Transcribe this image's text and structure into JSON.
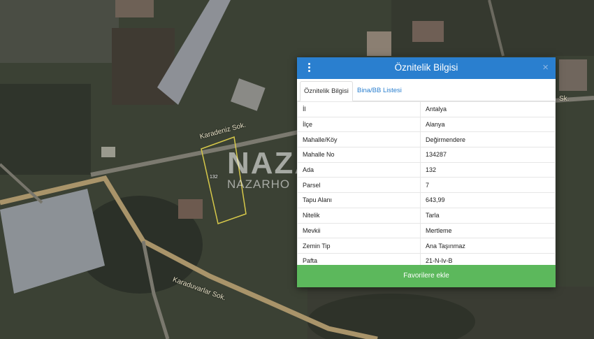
{
  "map": {
    "road_label_1": "Karadeniz Sok.",
    "road_label_2": "Karaduvarlar Sok.",
    "road_label_3": "Sk.",
    "parcel_number": "132",
    "watermark_main": "NAZAR",
    "watermark_sub": "NAZARHO"
  },
  "dialog": {
    "title": "Öznitelik Bilgisi",
    "close": "×",
    "tabs": [
      {
        "label": "Öznitelik Bilgisi",
        "active": true
      },
      {
        "label": "Bina/BB Listesi",
        "active": false
      }
    ],
    "rows": [
      {
        "key": "İl",
        "value": "Antalya"
      },
      {
        "key": "İlçe",
        "value": "Alanya"
      },
      {
        "key": "Mahalle/Köy",
        "value": "Değirmendere"
      },
      {
        "key": "Mahalle No",
        "value": "134287"
      },
      {
        "key": "Ada",
        "value": "132"
      },
      {
        "key": "Parsel",
        "value": "7"
      },
      {
        "key": "Tapu Alanı",
        "value": "643,99"
      },
      {
        "key": "Nitelik",
        "value": "Tarla"
      },
      {
        "key": "Mevkii",
        "value": "Mertleme"
      },
      {
        "key": "Zemin Tip",
        "value": "Ana Taşınmaz"
      },
      {
        "key": "Pafta",
        "value": "21-N-Iv-B"
      }
    ],
    "favorite_button": "Favorilere ekle"
  }
}
